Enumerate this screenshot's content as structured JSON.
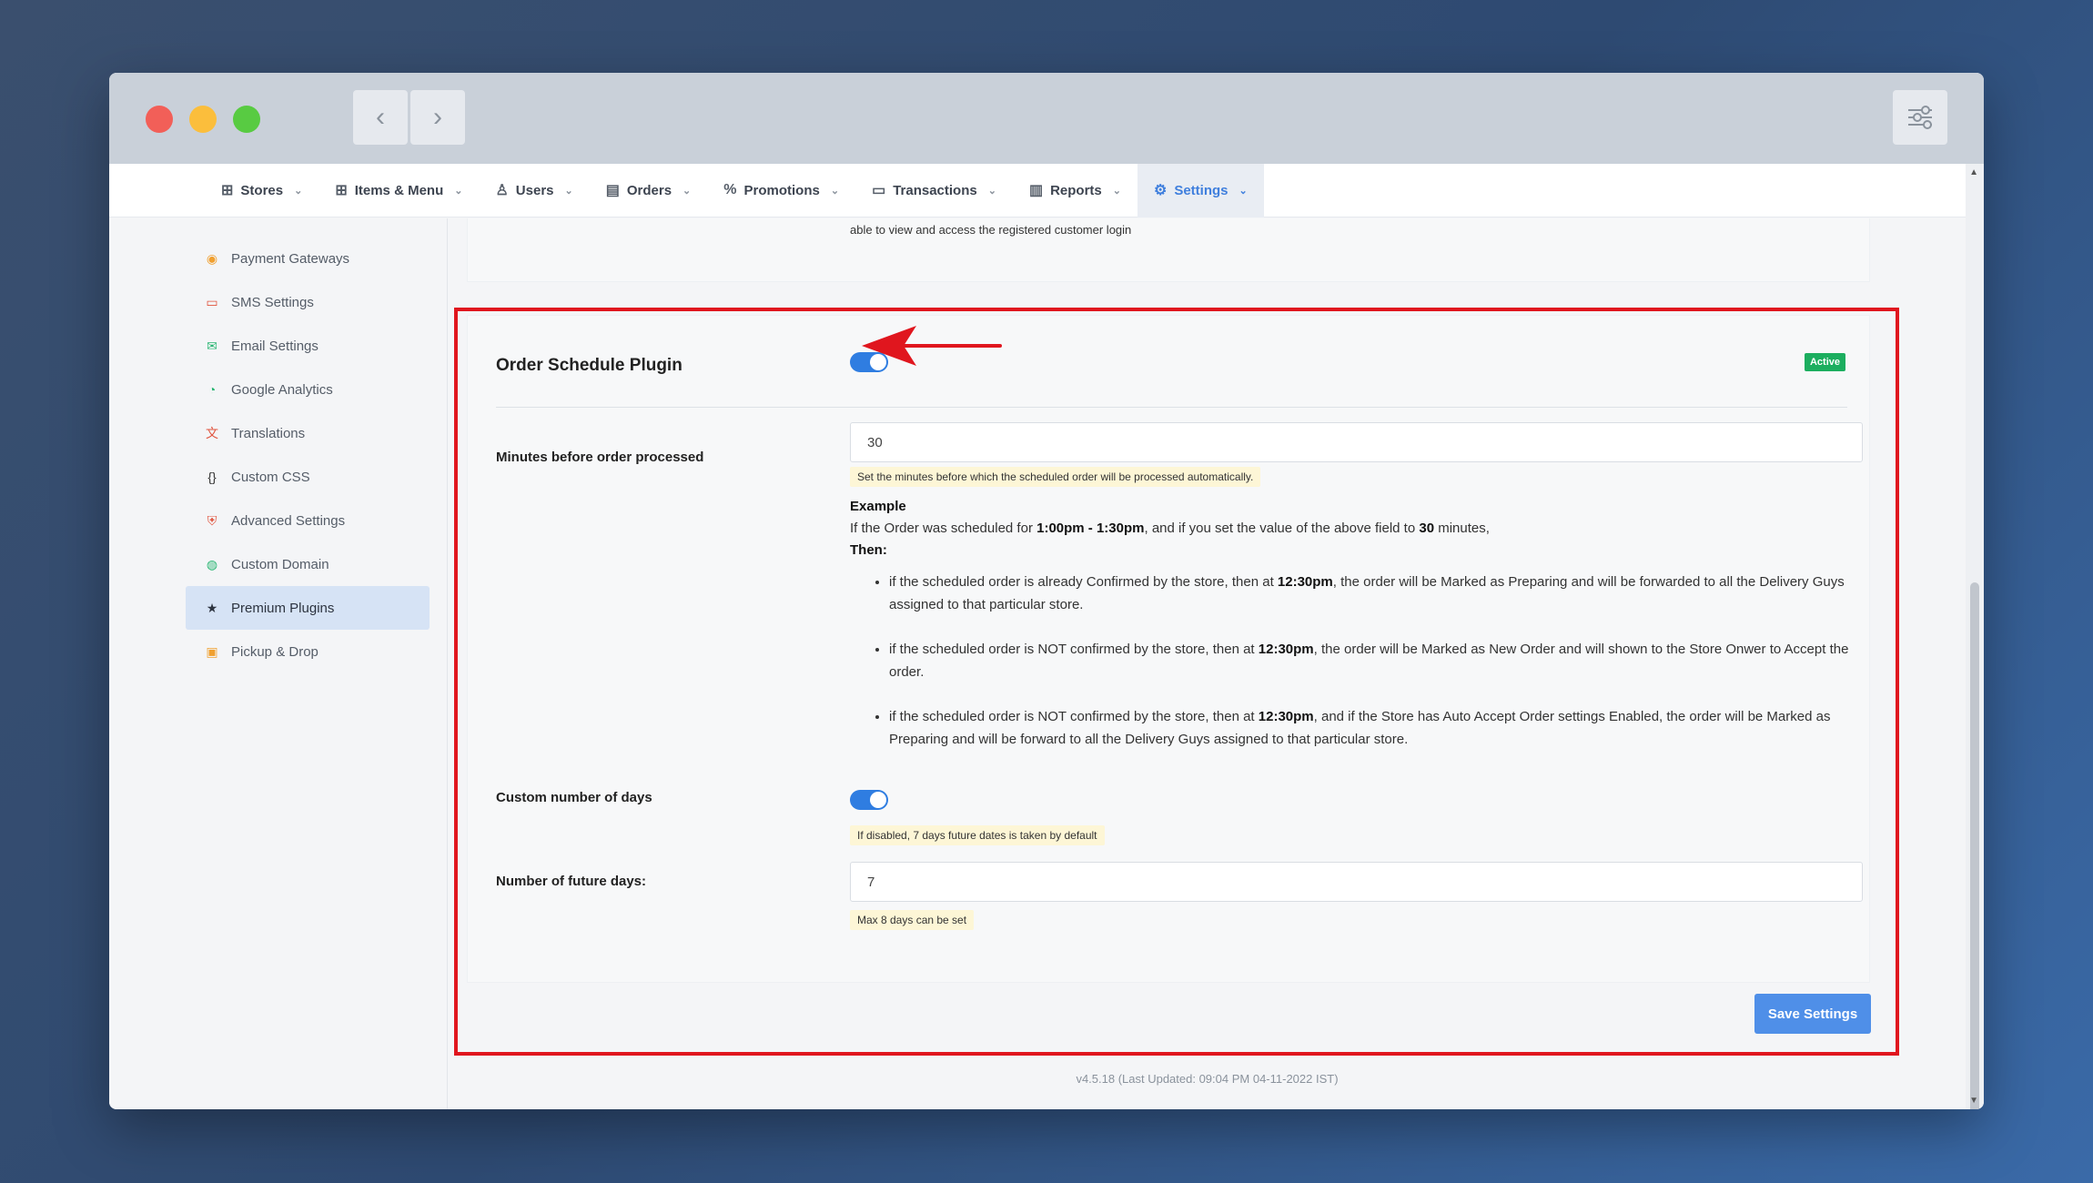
{
  "nav": {
    "items": [
      {
        "label": "Stores",
        "icon": "grid-icon"
      },
      {
        "label": "Items & Menu",
        "icon": "grid-icon"
      },
      {
        "label": "Users",
        "icon": "user-icon"
      },
      {
        "label": "Orders",
        "icon": "archive-icon"
      },
      {
        "label": "Promotions",
        "icon": "percent-icon"
      },
      {
        "label": "Transactions",
        "icon": "receipt-icon"
      },
      {
        "label": "Reports",
        "icon": "bar-chart-icon"
      },
      {
        "label": "Settings",
        "icon": "gear-icon"
      }
    ],
    "active": "Settings"
  },
  "sidebar": {
    "items": [
      {
        "label": "Payment Gateways",
        "icon": "wallet-icon",
        "color": "#f0a030"
      },
      {
        "label": "SMS Settings",
        "icon": "message-icon",
        "color": "#e0533d"
      },
      {
        "label": "Email Settings",
        "icon": "mail-icon",
        "color": "#2bb673"
      },
      {
        "label": "Google Analytics",
        "icon": "pie-chart-icon",
        "color": "#2bb673"
      },
      {
        "label": "Translations",
        "icon": "translate-icon",
        "color": "#e0533d"
      },
      {
        "label": "Custom CSS",
        "icon": "braces-icon",
        "color": "#333333"
      },
      {
        "label": "Advanced Settings",
        "icon": "shield-icon",
        "color": "#e0533d"
      },
      {
        "label": "Custom Domain",
        "icon": "globe-icon",
        "color": "#2bb673"
      },
      {
        "label": "Premium Plugins",
        "icon": "star-icon",
        "color": "#2d3440"
      },
      {
        "label": "Pickup & Drop",
        "icon": "box-icon",
        "color": "#f0a030"
      }
    ],
    "active": "Premium Plugins"
  },
  "top_card": {
    "text": "able to view and access the registered customer login"
  },
  "plugin": {
    "title": "Order Schedule Plugin",
    "enabled": true,
    "status_badge": "Active",
    "minutes_label": "Minutes before order processed",
    "minutes_value": "30",
    "minutes_hint": "Set the minutes before which the scheduled order will be processed automatically.",
    "example_title": "Example",
    "example_intro": {
      "p1": "If the Order was scheduled for ",
      "time_range": "1:00pm - 1:30pm",
      "p2": ", and if you set the value of the above field to ",
      "minutes": "30",
      "p3": " minutes,"
    },
    "then_label": "Then:",
    "bullets": [
      {
        "a": "if the scheduled order is already Confirmed by the store, then at ",
        "time": "12:30pm",
        "b": ", the order will be Marked as Preparing and will be forwarded to all the Delivery Guys assigned to that particular store."
      },
      {
        "a": "if the scheduled order is NOT confirmed by the store, then at ",
        "time": "12:30pm",
        "b": ", the order will be Marked as New Order and will shown to the Store Onwer to Accept the order."
      },
      {
        "a": "if the scheduled order is NOT confirmed by the store, then at ",
        "time": "12:30pm",
        "b": ", and if the Store has Auto Accept Order settings Enabled, the order will be Marked as Preparing and will be forward to all the Delivery Guys assigned to that particular store."
      }
    ],
    "custom_days_label": "Custom number of days",
    "custom_days_enabled": true,
    "custom_days_hint": "If disabled, 7 days future dates is taken by default",
    "future_days_label": "Number of future days:",
    "future_days_value": "7",
    "future_days_hint": "Max 8 days can be set"
  },
  "save_label": "Save Settings",
  "version": "v4.5.18 (Last Updated: 09:04 PM 04-11-2022 IST)",
  "colors": {
    "accent": "#2f7de1",
    "highlight": "#e0161e",
    "active_badge": "#1cae5f"
  }
}
